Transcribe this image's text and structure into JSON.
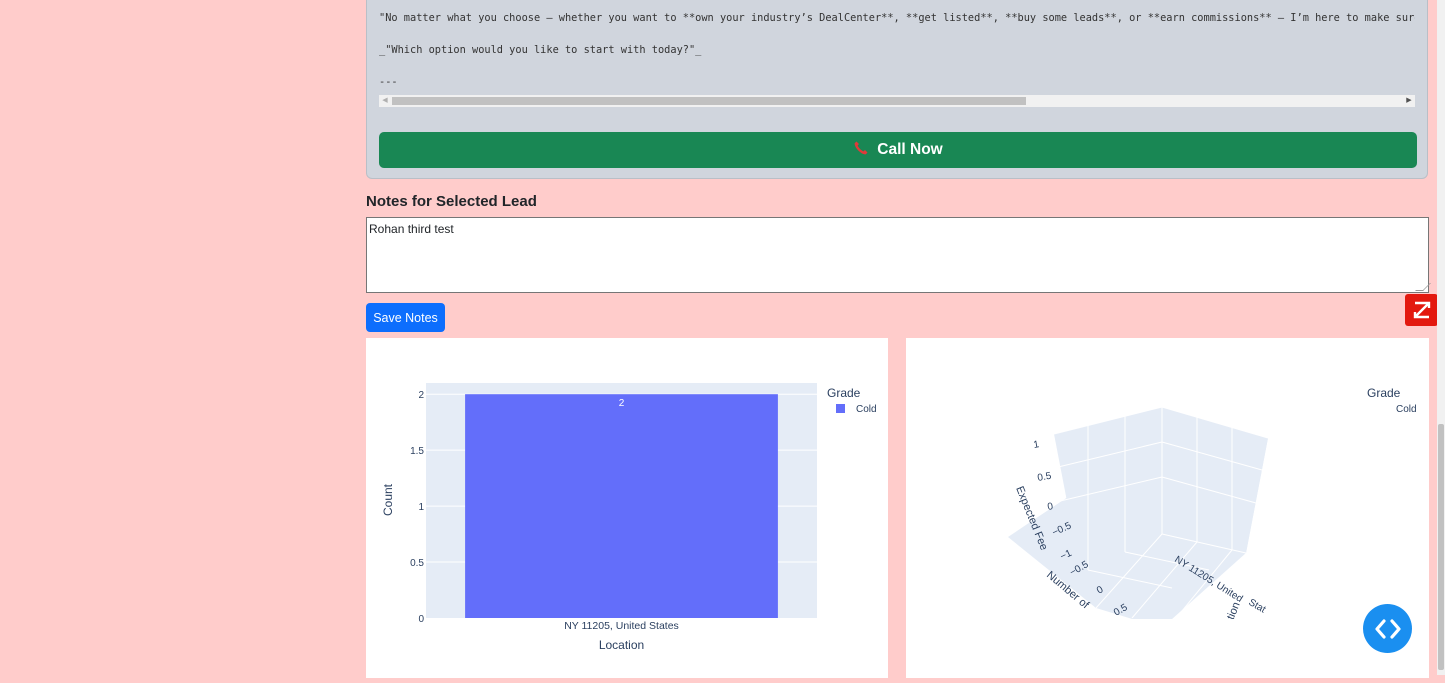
{
  "script": {
    "lines": [
      "\"No matter what you choose — whether you want to **own your industry’s DealCenter**, **get listed**, **buy some leads**, or **earn commissions** — I’m here to make sure you win.\"",
      "_\"Which option would you like to start with today?\"_",
      "---"
    ],
    "call_label": "Call Now"
  },
  "notes": {
    "title": "Notes for Selected Lead",
    "value": "Rohan third test",
    "save_label": "Save Notes"
  },
  "chart_data": [
    {
      "type": "bar",
      "categories": [
        "NY 11205, United States"
      ],
      "series": [
        {
          "name": "Cold",
          "values": [
            2
          ],
          "color": "#636efa"
        }
      ],
      "data_labels": [
        "2"
      ],
      "xlabel": "Location",
      "ylabel": "Count",
      "yticks": [
        "0",
        "0.5",
        "1",
        "1.5",
        "2"
      ],
      "ylim": [
        0,
        2.1
      ],
      "legend_title": "Grade",
      "legend_placement": "top-right",
      "grid": true
    },
    {
      "type": "scatter3d",
      "legend_title": "Grade",
      "legend_entries": [
        "Cold"
      ],
      "axis_labels": {
        "z": "Expected Fee",
        "y": "Number of",
        "x": "NY 11205, United"
      },
      "partial_axis_labels": [
        "ation",
        "Stat"
      ],
      "z_ticks": [
        "1",
        "0.5",
        "0",
        "−0.5",
        "−1"
      ],
      "y_ticks": [
        "−0.5",
        "0",
        "0.5"
      ]
    }
  ]
}
